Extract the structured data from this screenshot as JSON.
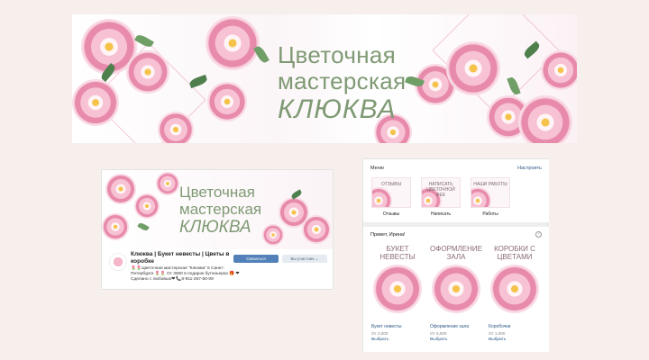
{
  "banner": {
    "line1": "Цветочная",
    "line2": "мастерская",
    "line3": "КЛЮКВА"
  },
  "community": {
    "cover": {
      "line1": "Цветочная",
      "line2": "мастерская",
      "line3": "КЛЮКВА"
    },
    "name": "Клюква | Букет невесты | Цветы в коробке",
    "status": "🌷🌷Цветочная мастерская \"Клюква\" в Санкт-Петербурге 🌷🌷 От 3500 в подарок бутоньерка 🎁 ❤Сделано с любовью❤ 📞8-911-257-50-09",
    "subscribe_label": "Связаться",
    "member_label": "Вы участник ⌄"
  },
  "menu": {
    "title": "Меню",
    "edit_label": "Настроить",
    "items": [
      {
        "caption": "ОТЗЫВЫ",
        "label": "Отзывы"
      },
      {
        "caption": "НАПИСАТЬ ЦВЕТОЧНОЙ ФЕЕ",
        "label": "Написать"
      },
      {
        "caption": "НАШИ РАБОТЫ",
        "label": "Работы"
      }
    ]
  },
  "market": {
    "title": "Привет, Ирина!",
    "info_icon": "?",
    "products": [
      {
        "caption": "Букет невесты",
        "name": "Букет невесты",
        "price": "От 2,000",
        "buy": "Выбрать"
      },
      {
        "caption": "Оформление зала",
        "name": "Оформление зала",
        "price": "От 5,000",
        "buy": "Выбрать"
      },
      {
        "caption": "Коробки с цветами",
        "name": "Коробочки",
        "price": "От 1,000",
        "buy": "Выбрать"
      }
    ]
  },
  "colors": {
    "accent_green": "#7f9a74",
    "link_blue": "#2a5885",
    "button_blue": "#5181b8",
    "background": "#f6efeb"
  }
}
